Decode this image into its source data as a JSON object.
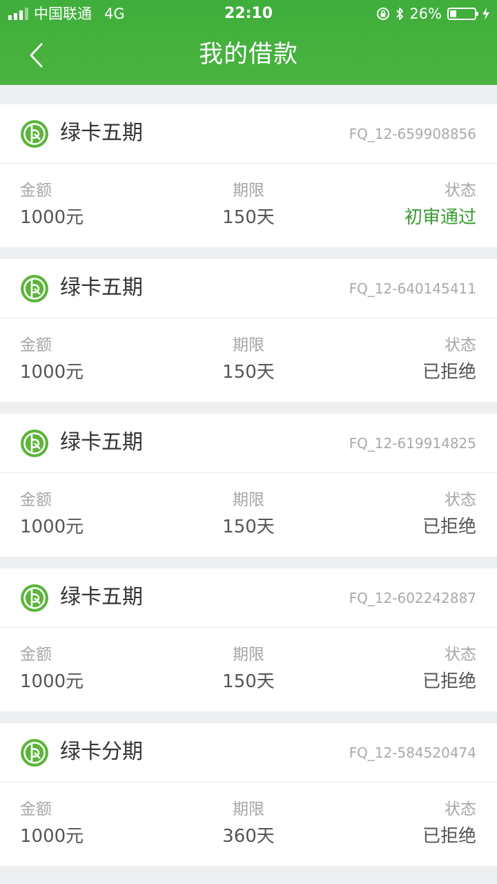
{
  "status_bar": {
    "carrier": "中国联通",
    "network": "4G",
    "time": "22:10",
    "battery": "26%",
    "battery_level": 0.26
  },
  "header": {
    "title": "我的借款"
  },
  "labels": {
    "amount": "金额",
    "term": "期限",
    "status": "状态"
  },
  "colors": {
    "brand_green": "#43b03e",
    "approved_green": "#3a9a33"
  },
  "loans": [
    {
      "product": "绿卡五期",
      "order_no": "FQ_12-659908856",
      "amount": "1000元",
      "term": "150天",
      "status": "初审通过"
    },
    {
      "product": "绿卡五期",
      "order_no": "FQ_12-640145411",
      "amount": "1000元",
      "term": "150天",
      "status": "已拒绝"
    },
    {
      "product": "绿卡五期",
      "order_no": "FQ_12-619914825",
      "amount": "1000元",
      "term": "150天",
      "status": "已拒绝"
    },
    {
      "product": "绿卡五期",
      "order_no": "FQ_12-602242887",
      "amount": "1000元",
      "term": "150天",
      "status": "已拒绝"
    },
    {
      "product": "绿卡分期",
      "order_no": "FQ_12-584520474",
      "amount": "1000元",
      "term": "360天",
      "status": "已拒绝"
    }
  ]
}
